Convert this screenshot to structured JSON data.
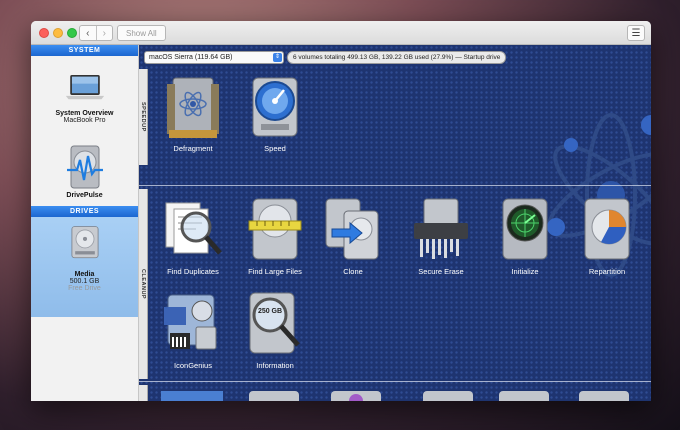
{
  "window": {
    "nav_back": "‹",
    "nav_forward": "›",
    "show_all": "Show All"
  },
  "sidebar": {
    "system_header": "SYSTEM",
    "drives_header": "DRIVES",
    "items": [
      {
        "name": "System Overview",
        "sub": "MacBook Pro"
      },
      {
        "name": "DrivePulse",
        "sub": ""
      },
      {
        "name": "Media",
        "sub": "500.1 GB",
        "status": "Free Drive"
      }
    ]
  },
  "toolbar": {
    "volume_selected": "macOS Sierra (119.64 GB)",
    "volume_info": "6 volumes totaling 499.13 GB, 139.22 GB used (27.9%) — Startup drive"
  },
  "sections": {
    "speedup": "SPEEDUP",
    "cleanup": "CLEANUP"
  },
  "tools": {
    "defragment": "Defragment",
    "speed": "Speed",
    "find_duplicates": "Find Duplicates",
    "find_large_files": "Find Large Files",
    "clone": "Clone",
    "secure_erase": "Secure Erase",
    "initialize": "Initialize",
    "repartition": "Repartition",
    "icongenius": "IconGenius",
    "information": "Information",
    "info_badge": "250 GB"
  },
  "colors": {
    "accent": "#1c66cf",
    "main_bg": "#1e3470"
  }
}
